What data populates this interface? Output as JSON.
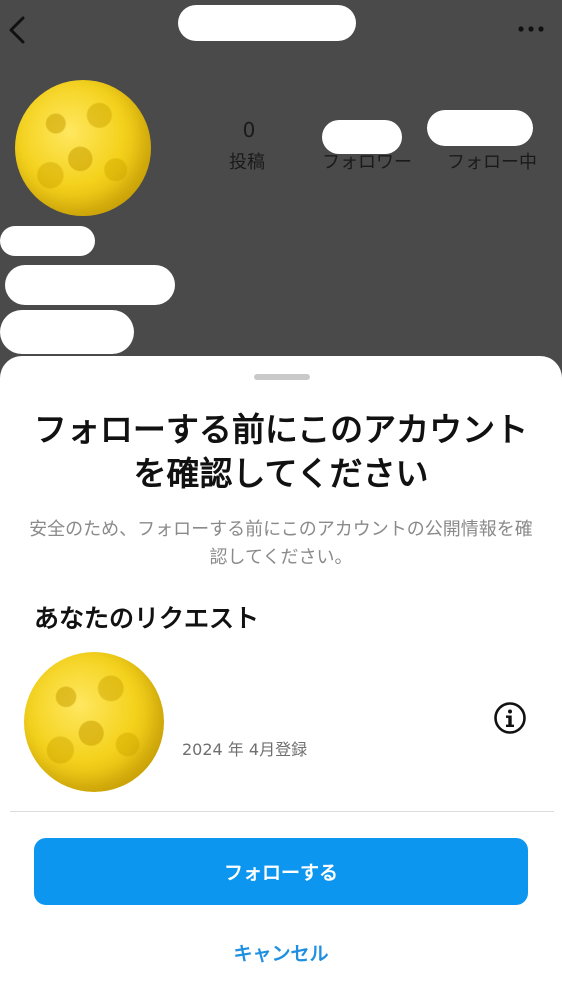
{
  "header": {
    "back_icon": "chevron-left-icon",
    "more_icon": "more-horizontal-icon"
  },
  "profile": {
    "posts_count": "0",
    "posts_label": "投稿",
    "followers_label": "フォロワー",
    "following_label": "フォロー中"
  },
  "sheet": {
    "title": "フォローする前にこのアカウントを確認してください",
    "description": "安全のため、フォローする前にこのアカウントの公開情報を確認してください。",
    "section_title": "あなたのリクエスト",
    "joined_text": "2024 年 4月登録",
    "info_icon": "info-icon",
    "follow_label": "フォローする",
    "cancel_label": "キャンセル"
  },
  "colors": {
    "overlay": "#4a4a4a",
    "primary": "#0d96f0",
    "link": "#1f8fe0"
  }
}
